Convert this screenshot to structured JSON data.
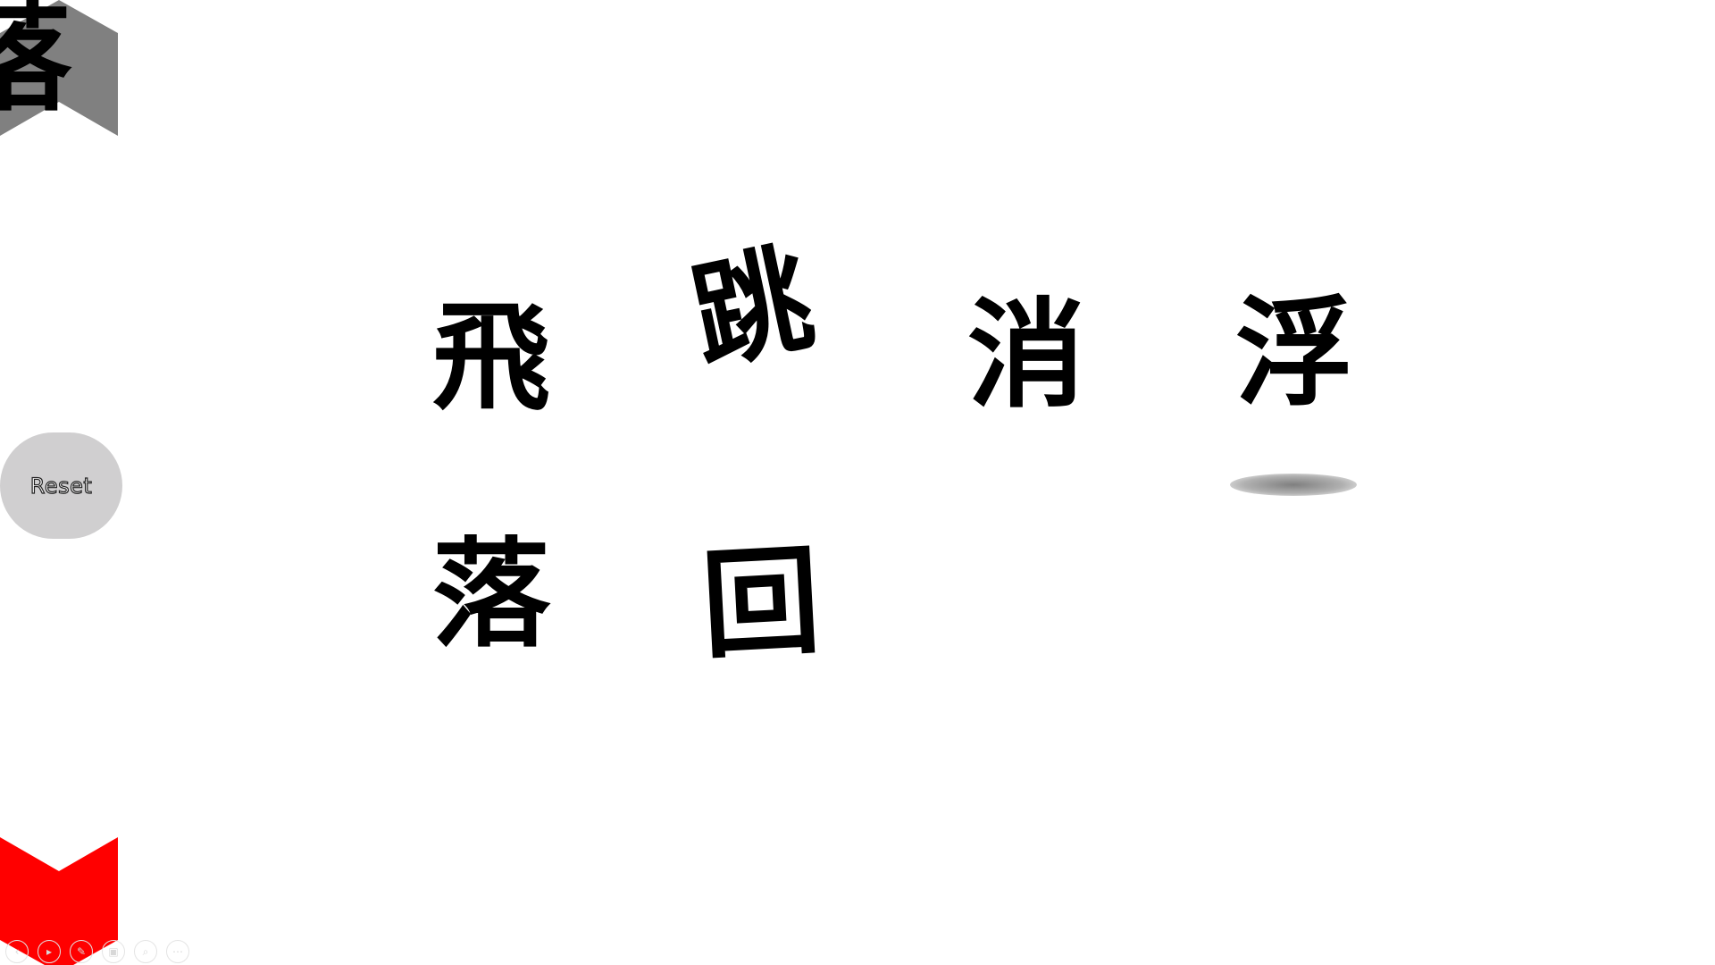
{
  "slide": {
    "characters": {
      "fly": "飛",
      "jump": "跳",
      "vanish": "消",
      "float": "浮",
      "fall": "落",
      "return": "回",
      "partial": "落"
    },
    "reset_label": "Reset"
  },
  "navigation": {
    "prev_icon": "chevron-up-icon",
    "next_icon": "chevron-down-icon",
    "prev_color": "#808080",
    "next_color": "#ff0000"
  },
  "toolbar": {
    "buttons": [
      {
        "icon": "previous-icon",
        "glyph": "‹"
      },
      {
        "icon": "play-icon",
        "glyph": "▸"
      },
      {
        "icon": "pen-icon",
        "glyph": "✎"
      },
      {
        "icon": "slides-icon",
        "glyph": "▣"
      },
      {
        "icon": "zoom-icon",
        "glyph": "⌕"
      },
      {
        "icon": "more-icon",
        "glyph": "⋯"
      }
    ]
  }
}
